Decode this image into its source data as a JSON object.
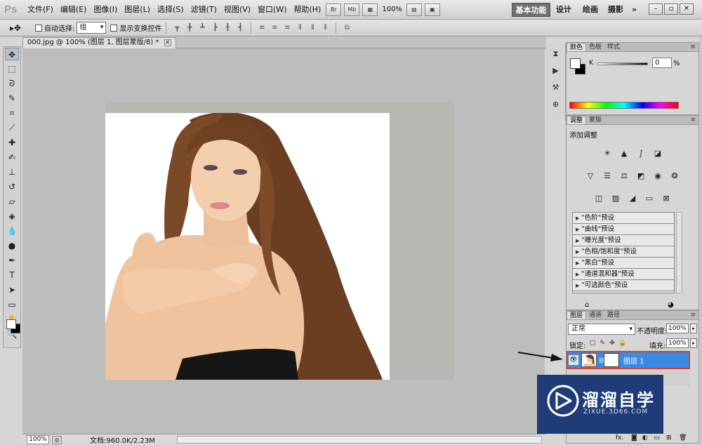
{
  "app": {
    "logo": "Ps",
    "menu": [
      "文件(F)",
      "编辑(E)",
      "图像(I)",
      "图层(L)",
      "选择(S)",
      "滤镜(T)",
      "视图(V)",
      "窗口(W)",
      "帮助(H)"
    ],
    "bridge_label": "Br",
    "minibridge_label": "Mb",
    "zoom": "100%",
    "workspaces": {
      "active": "基本功能",
      "design": "设计",
      "painting": "绘画",
      "photography": "摄影",
      "more": "»"
    },
    "window_controls": {
      "minimize": "–",
      "restore": "▫",
      "close": "✕"
    }
  },
  "options_bar": {
    "tool_glyph": "▸✥",
    "auto_select_label": "自动选择:",
    "auto_select_value": "组",
    "show_transform_label": "显示变换控件"
  },
  "document": {
    "tab_title": "000.jpg @ 100% (图层 1, 图层蒙版/8) *",
    "tab_close": "✕",
    "status_zoom": "100%",
    "status_info": "文档:960.0K/2.23M"
  },
  "panels": {
    "color": {
      "tabs": [
        "颜色",
        "色板",
        "样式"
      ],
      "k_label": "K",
      "k_value": "0",
      "k_unit": "%"
    },
    "adjustments": {
      "tabs": [
        "调整",
        "蒙版"
      ],
      "title": "添加调整",
      "presets": [
        "\"色阶\"预设",
        "\"曲线\"预设",
        "\"曝光度\"预设",
        "\"色相/饱和度\"预设",
        "\"黑白\"预设",
        "\"通道混和器\"预设",
        "\"可选颜色\"预设"
      ]
    },
    "layers": {
      "tabs": [
        "图层",
        "通道",
        "路径"
      ],
      "blend_mode": "正常",
      "opacity_label": "不透明度:",
      "opacity_value": "100%",
      "lock_label": "锁定:",
      "fill_label": "填充:",
      "fill_value": "100%",
      "layer_name": "图层 1"
    }
  },
  "watermark": {
    "name": "溜溜自学",
    "url": "ZIXUE.3D66.COM"
  },
  "colors": {
    "selection_blue": "#3b8ae6",
    "highlight_red": "#d5412c",
    "watermark_bg": "#1f3c78"
  }
}
